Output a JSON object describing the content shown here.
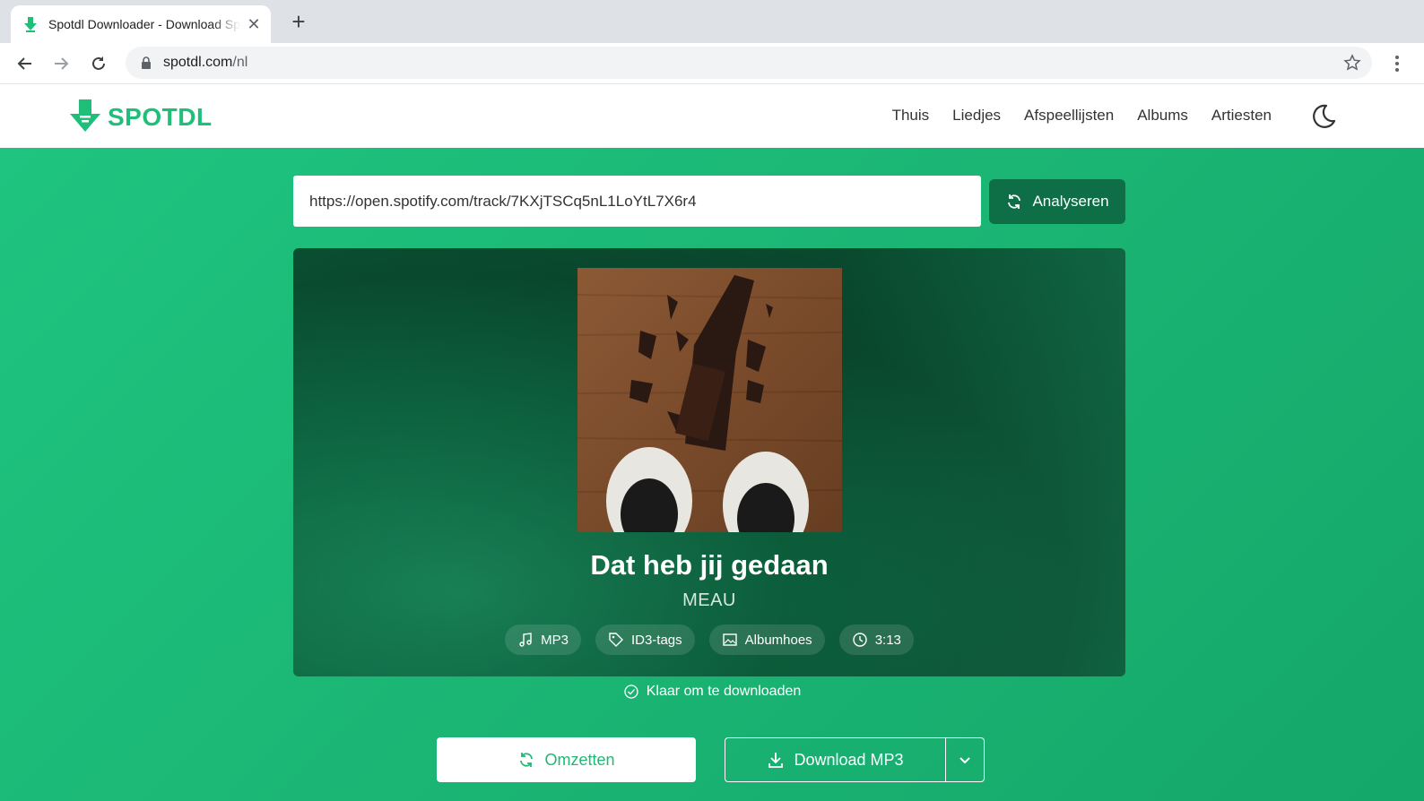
{
  "browser": {
    "tab_title": "Spotdl Downloader - Download Spotify",
    "tab_close": "✕",
    "new_tab": "+",
    "url_host": "spotdl.com",
    "url_path": "/nl"
  },
  "header": {
    "logo_text": "SPOTDL",
    "nav": [
      "Thuis",
      "Liedjes",
      "Afspeellijsten",
      "Albums",
      "Artiesten"
    ],
    "theme_icon": "moon-icon"
  },
  "search": {
    "value": "https://open.spotify.com/track/7KXjTSCq5nL1LoYtL7X6r4",
    "button_label": "Analyseren",
    "button_icon": "refresh-icon"
  },
  "track": {
    "title": "Dat heb jij gedaan",
    "artist": "MEAU",
    "cover_alt": "album-cover",
    "chips": [
      {
        "icon": "music-note-icon",
        "label": "MP3"
      },
      {
        "icon": "tag-icon",
        "label": "ID3-tags"
      },
      {
        "icon": "image-icon",
        "label": "Albumhoes"
      },
      {
        "icon": "clock-icon",
        "label": "3:13"
      }
    ]
  },
  "status": {
    "text": "Klaar om te downloaden",
    "icon": "check-circle-icon"
  },
  "actions": {
    "convert_label": "Omzetten",
    "download_label": "Download MP3",
    "caret_icon": "chevron-down-icon"
  },
  "colors": {
    "brand_green": "#1fbf7a",
    "dark_green": "#0e6e45",
    "card_bg": "#0a4f32"
  }
}
